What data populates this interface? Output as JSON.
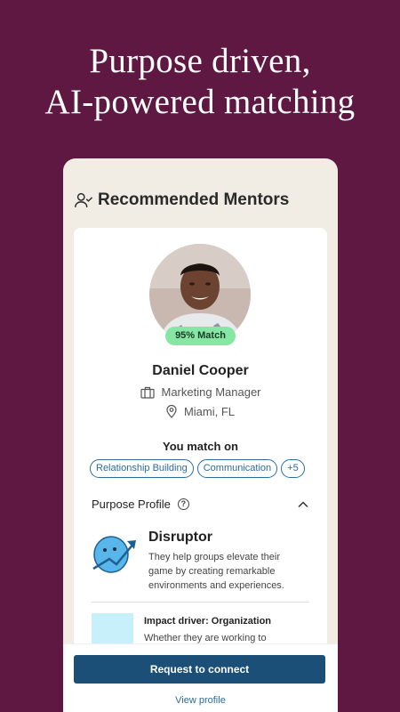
{
  "headline": {
    "line1": "Purpose driven,",
    "line2": "AI-powered matching"
  },
  "section": {
    "title": "Recommended Mentors",
    "icon": "user-check-icon"
  },
  "mentor": {
    "match_badge": "95% Match",
    "name": "Daniel Cooper",
    "role": "Marketing Manager",
    "location": "Miami, FL",
    "match_on_label": "You match on",
    "chips": [
      "Relationship Building",
      "Communication",
      "+5"
    ]
  },
  "purpose_profile": {
    "title": "Purpose Profile",
    "help_symbol": "?",
    "type_title": "Disruptor",
    "type_description": "They help groups elevate their game by creating remarkable environments and experiences.",
    "impact_title": "Impact driver: Organization",
    "impact_description": "Whether they are working to"
  },
  "actions": {
    "connect_label": "Request to connect",
    "view_profile_label": "View profile"
  },
  "colors": {
    "background": "#5e1841",
    "primary_button": "#1b4f78",
    "match_badge": "#86e6a4",
    "link": "#2c6b9e"
  }
}
